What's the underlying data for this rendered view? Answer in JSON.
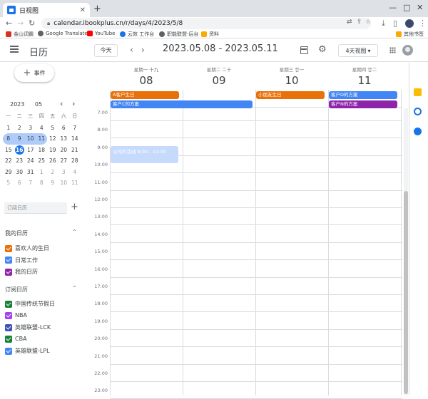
{
  "browser": {
    "tab_title": "日视图",
    "url": "calendar.ibookplus.cn/r/days/4/2023/5/8",
    "bookmarks": [
      {
        "label": "金山词霸",
        "color": "#d93025"
      },
      {
        "label": "Google Translate",
        "color": "#5f6368"
      },
      {
        "label": "YouTube",
        "color": "#ff0000"
      },
      {
        "label": "云效 工作台",
        "color": "#1a73e8"
      },
      {
        "label": "职能联盟-后台",
        "color": "#5f6368"
      },
      {
        "label": "资料",
        "color": "#f9ab00"
      }
    ],
    "other_bookmarks": "其他书签"
  },
  "header": {
    "app_title": "日历",
    "today_label": "今天",
    "range": "2023.05.08 - 2023.05.11",
    "view_label": "4天视图"
  },
  "sidebar": {
    "create_label": "事件",
    "mini_calendar": {
      "year": "2023",
      "month": "05",
      "dow": [
        "一",
        "二",
        "三",
        "四",
        "五",
        "六",
        "日"
      ],
      "weeks": [
        [
          "1",
          "2",
          "3",
          "4",
          "5",
          "6",
          "7"
        ],
        [
          "8",
          "9",
          "10",
          "11",
          "12",
          "13",
          "14"
        ],
        [
          "15",
          "16",
          "17",
          "18",
          "19",
          "20",
          "21"
        ],
        [
          "22",
          "23",
          "24",
          "25",
          "26",
          "27",
          "28"
        ],
        [
          "29",
          "30",
          "31",
          "1",
          "2",
          "3",
          "4"
        ],
        [
          "5",
          "6",
          "7",
          "8",
          "9",
          "10",
          "11"
        ]
      ],
      "today": "16"
    },
    "subscribe_placeholder": "订阅日历",
    "my_calendars_title": "我的日历",
    "my_calendars": [
      {
        "label": "喜欢人的生日",
        "color": "#e8710a"
      },
      {
        "label": "日常工作",
        "color": "#4285f4"
      },
      {
        "label": "我的日历",
        "color": "#8e24aa"
      }
    ],
    "subscribed_title": "订阅日历",
    "subscribed": [
      {
        "label": "中国传统节假日",
        "color": "#188038"
      },
      {
        "label": "NBA",
        "color": "#a142f4"
      },
      {
        "label": "英雄联盟-LCK",
        "color": "#3f51b5"
      },
      {
        "label": "CBA",
        "color": "#188038"
      },
      {
        "label": "英雄联盟-LPL",
        "color": "#4285f4"
      }
    ]
  },
  "days": [
    {
      "dow": "星期一 十九",
      "num": "08"
    },
    {
      "dow": "星期二 二十",
      "num": "09"
    },
    {
      "dow": "星期三 廿一",
      "num": "10"
    },
    {
      "dow": "星期四 廿二",
      "num": "11"
    }
  ],
  "times": [
    "7:00",
    "8:00",
    "9:00",
    "10:00",
    "11:00",
    "12:00",
    "13:00",
    "14:00",
    "15:00",
    "16:00",
    "17:00",
    "18:00",
    "19:00",
    "20:00",
    "21:00",
    "22:00",
    "23:00"
  ],
  "allday_events": [
    {
      "title": "A客户生日",
      "color": "#e8710a"
    },
    {
      "title": "客户C的方案",
      "color": "#4285f4"
    },
    {
      "title": "小朋友生日",
      "color": "#e8710a"
    },
    {
      "title": "客户D的方案",
      "color": "#4285f4"
    },
    {
      "title": "客户N的方案",
      "color": "#8e24aa"
    }
  ],
  "timed_event": {
    "title": "公司的活动  9:00 - 10:00",
    "color": "#c6dafc"
  }
}
